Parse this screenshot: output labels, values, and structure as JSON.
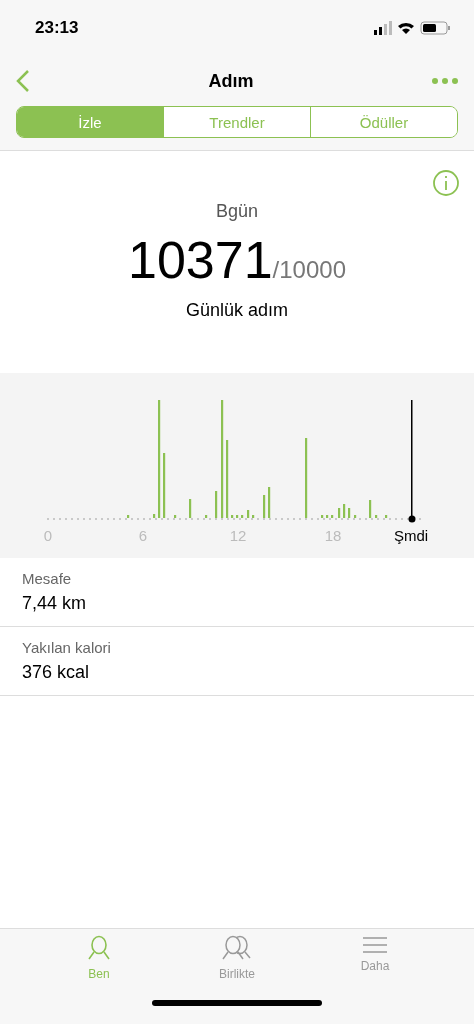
{
  "status_bar": {
    "time": "23:13"
  },
  "nav": {
    "title": "Adım"
  },
  "tabs": [
    {
      "label": "İzle",
      "selected": true
    },
    {
      "label": "Trendler",
      "selected": false
    },
    {
      "label": "Ödüller",
      "selected": false
    }
  ],
  "summary": {
    "period": "Bgün",
    "value": "10371",
    "goal": "/10000",
    "caption": "Günlük adım"
  },
  "chart": {
    "axis_labels": [
      "0",
      "6",
      "12",
      "18"
    ],
    "now_label": "Şmdi"
  },
  "metrics": [
    {
      "label": "Mesafe",
      "value": "7,44 km"
    },
    {
      "label": "Yakılan kalori",
      "value": "376 kcal"
    }
  ],
  "bottom_tabs": [
    {
      "label": "Ben",
      "kind": "person",
      "selected": true
    },
    {
      "label": "Birlikte",
      "kind": "people",
      "selected": false
    },
    {
      "label": "Daha",
      "kind": "menu",
      "selected": false
    }
  ]
}
